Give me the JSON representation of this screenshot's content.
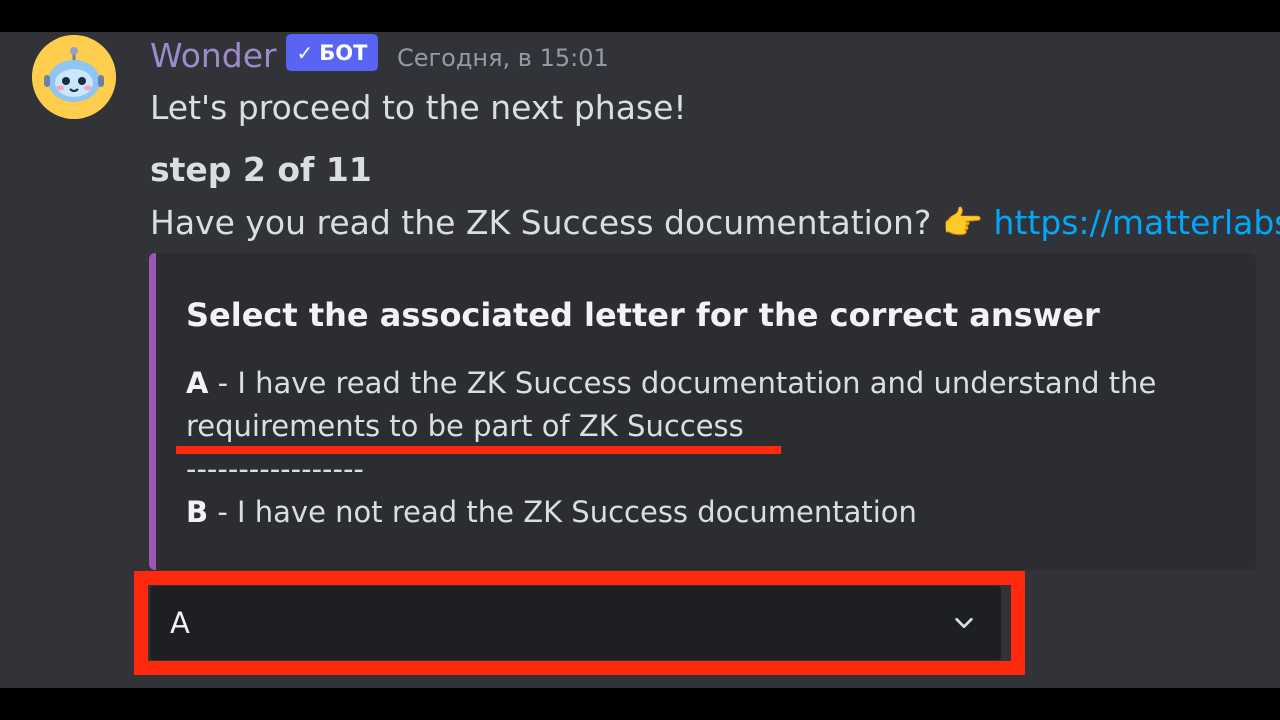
{
  "message": {
    "username": "Wonder",
    "bot_tag": "БОТ",
    "timestamp": "Сегодня, в 15:01",
    "line1": "Let's proceed to the next phase!",
    "step": "step 2 of 11",
    "question": "Have you read the ZK Success documentation?",
    "pointing_emoji": "👉",
    "link": "https://matterlabs"
  },
  "embed": {
    "title": "Select the associated letter for the correct answer",
    "option_a_letter": "A",
    "option_a_text": " - I have read the ZK Success documentation and understand the requirements to be part of ZK Success",
    "separator": "-----------------",
    "option_b_letter": "B",
    "option_b_text": " - I have not read the ZK Success documentation",
    "accent_color": "#9B59B6"
  },
  "select_menu": {
    "selected_value": "A",
    "icon": "chevron-down-icon"
  },
  "annotation_color": "#FF2A0E"
}
